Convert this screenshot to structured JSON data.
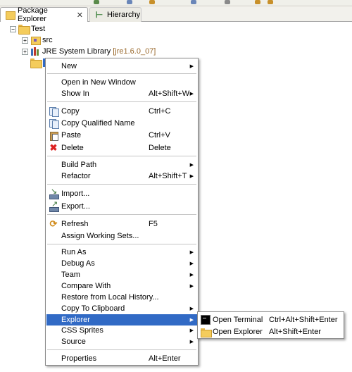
{
  "tabs": [
    {
      "label": "Package Explorer",
      "close": "✕"
    },
    {
      "label": "Hierarchy"
    }
  ],
  "tree": {
    "project": "Test",
    "src": "src",
    "jre": "JRE System Library",
    "jre_decor": "[jre1.6.0_07]",
    "expander_collapsed": "+",
    "expander_expanded": "−"
  },
  "menu": {
    "items": [
      {
        "label": "New",
        "accel": "",
        "submenu": true
      },
      {
        "label": "Open in New Window",
        "accel": ""
      },
      {
        "label": "Show In",
        "accel": "Alt+Shift+W",
        "submenu": true
      },
      {
        "label": "Copy",
        "accel": "Ctrl+C",
        "icon": "copy-icon"
      },
      {
        "label": "Copy Qualified Name",
        "accel": "",
        "icon": "copy-qualified-name-icon"
      },
      {
        "label": "Paste",
        "accel": "Ctrl+V",
        "icon": "paste-icon"
      },
      {
        "label": "Delete",
        "accel": "Delete",
        "icon": "delete-icon"
      },
      {
        "label": "Build Path",
        "accel": "",
        "submenu": true
      },
      {
        "label": "Refactor",
        "accel": "Alt+Shift+T",
        "submenu": true
      },
      {
        "label": "Import...",
        "accel": "",
        "icon": "import-icon"
      },
      {
        "label": "Export...",
        "accel": "",
        "icon": "export-icon"
      },
      {
        "label": "Refresh",
        "accel": "F5",
        "icon": "refresh-icon"
      },
      {
        "label": "Assign Working Sets...",
        "accel": ""
      },
      {
        "label": "Run As",
        "accel": "",
        "submenu": true
      },
      {
        "label": "Debug As",
        "accel": "",
        "submenu": true
      },
      {
        "label": "Team",
        "accel": "",
        "submenu": true
      },
      {
        "label": "Compare With",
        "accel": "",
        "submenu": true
      },
      {
        "label": "Restore from Local History...",
        "accel": ""
      },
      {
        "label": "Copy To Clipboard",
        "accel": "",
        "submenu": true
      },
      {
        "label": "Explorer",
        "accel": "",
        "submenu": true,
        "highlighted": true
      },
      {
        "label": "CSS Sprites",
        "accel": "",
        "submenu": true
      },
      {
        "label": "Source",
        "accel": "",
        "submenu": true
      },
      {
        "label": "Properties",
        "accel": "Alt+Enter"
      }
    ],
    "submenu_arrow": "▶"
  },
  "submenu": {
    "items": [
      {
        "label": "Open Terminal",
        "accel": "Ctrl+Alt+Shift+Enter",
        "icon": "terminal-icon"
      },
      {
        "label": "Open Explorer",
        "accel": "Alt+Shift+Enter",
        "icon": "folder-icon"
      }
    ]
  },
  "colors": {
    "selection": "#316ac5",
    "menu_border": "#8a8a8a",
    "tab_bg": "#f2f1ec"
  }
}
